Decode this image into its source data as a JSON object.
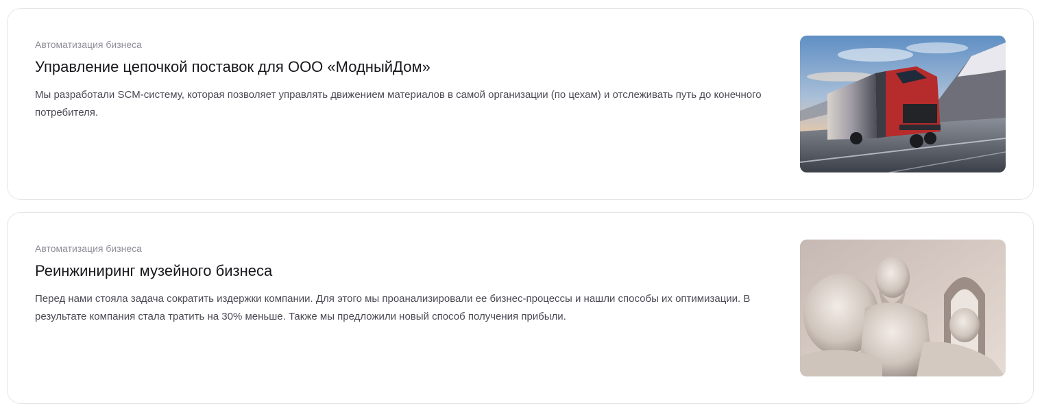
{
  "cases": [
    {
      "category": "Автоматизация бизнеса",
      "title": "Управление цепочкой поставок для ООО «МодныйДом»",
      "description": "Мы разработали SCM-систему, которая позволяет управлять движением материалов в самой организации (по цехам) и отслеживать путь до конечного потребителя.",
      "image_icon": "truck-on-mountain-road-image"
    },
    {
      "category": "Автоматизация бизнеса",
      "title": "Реинжиниринг музейного бизнеса",
      "description": "Перед нами стояла задача сократить издержки компании. Для этого мы проанализировали ее бизнес-процессы и нашли способы их оптимизации. В результате компания стала тратить на 30% меньше. Также мы предложили новый способ получения прибыли.",
      "image_icon": "marble-statue-image"
    }
  ],
  "colors": {
    "card_border": "#e6e6ea",
    "category_text": "#8e8e99",
    "title_text": "#17171c",
    "description_text": "#4a4a54"
  }
}
